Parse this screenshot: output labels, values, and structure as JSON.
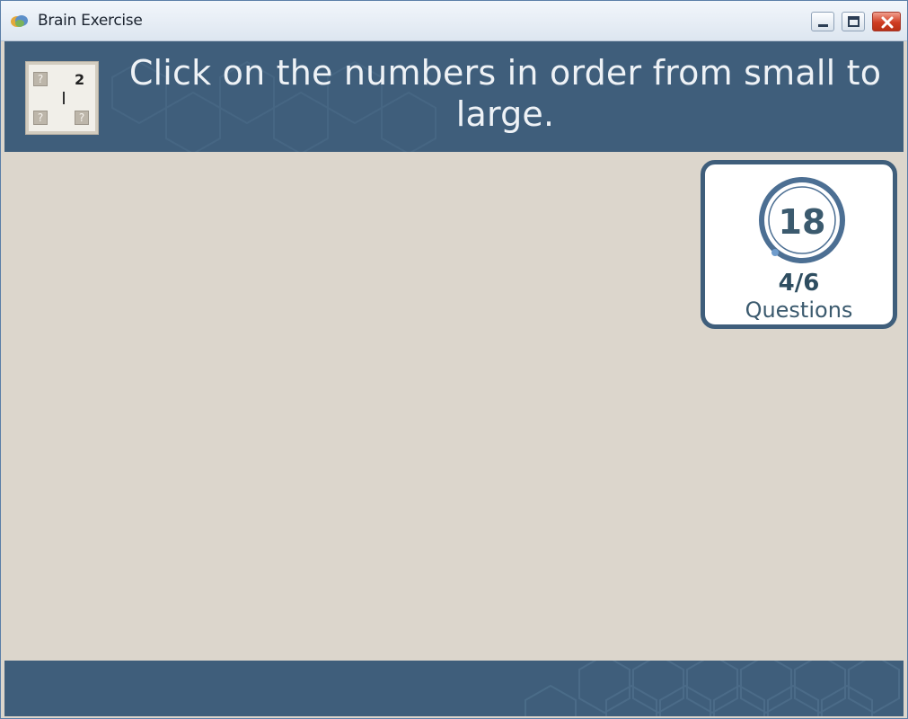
{
  "window": {
    "title": "Brain Exercise",
    "icon": "brain-icon",
    "controls": [
      "minimize-icon",
      "maximize-icon",
      "close-icon"
    ]
  },
  "header": {
    "instruction": "Click on the numbers in order from small to large.",
    "thumbnail": {
      "revealed_number": "2",
      "hidden_marker": "?"
    }
  },
  "status": {
    "timer": "18",
    "question_progress": "4/6",
    "question_label": "Questions"
  },
  "colors": {
    "band": "#3f5e7b",
    "background": "#dcd6cc",
    "card_border": "#3f5e7b",
    "close_button": "#cf3d22"
  }
}
